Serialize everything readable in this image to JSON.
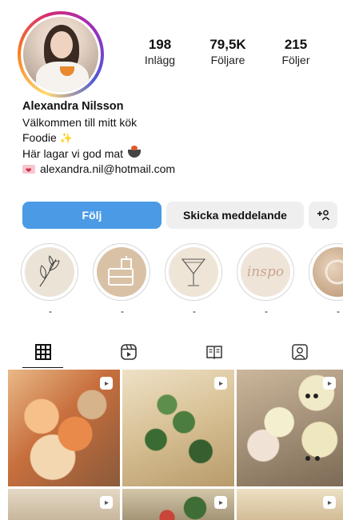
{
  "profile": {
    "posts_count": "198",
    "posts_label": "Inlägg",
    "followers_count": "79,5K",
    "followers_label": "Följare",
    "following_count": "215",
    "following_label": "Följer"
  },
  "bio": {
    "name": "Alexandra Nilsson",
    "line1": "Välkommen till mitt kök",
    "line2": "Foodie",
    "line3": "Här lagar vi god mat",
    "email": "alexandra.nil@hotmail.com"
  },
  "actions": {
    "follow_label": "Följ",
    "message_label": "Skicka meddelande",
    "add_user_label": "+ᴬ"
  },
  "highlights": [
    {
      "label": "-",
      "icon": "leaf-icon"
    },
    {
      "label": "-",
      "icon": "food-container-icon"
    },
    {
      "label": "-",
      "icon": "cocktail-glass-icon"
    },
    {
      "label": "-",
      "icon": "inspo-text",
      "text": "inspo"
    },
    {
      "label": "-",
      "icon": "photo-icon"
    }
  ],
  "tabs": [
    {
      "name": "grid-icon"
    },
    {
      "name": "reels-icon"
    },
    {
      "name": "guides-icon"
    },
    {
      "name": "tagged-icon"
    }
  ],
  "colors": {
    "follow_button": "#4b9ae6",
    "secondary_button": "#efefef"
  }
}
